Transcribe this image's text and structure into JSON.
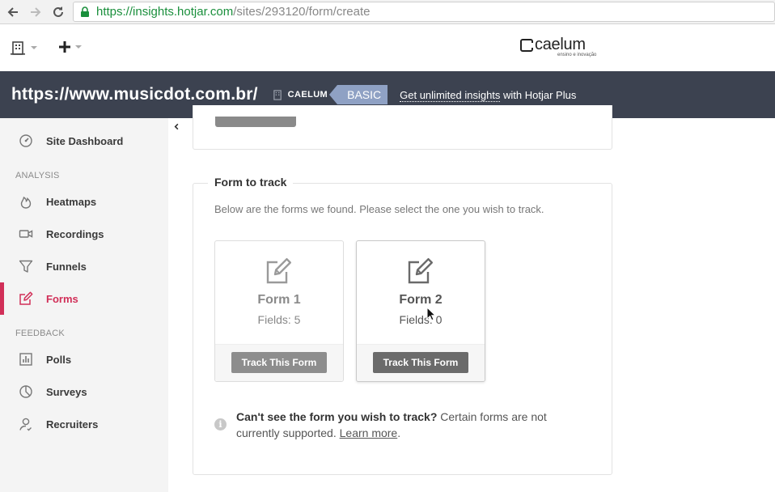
{
  "browser": {
    "url_secure_part": "https://insights.hotjar.com",
    "url_path": "/sites/293120/form/create"
  },
  "top_bar": {
    "brand_name": "caelum",
    "brand_tagline": "ensino e inovação"
  },
  "site_header": {
    "site_url": "https://www.musicdot.com.br/",
    "org_name": "CAELUM",
    "plan": "BASIC",
    "upsell_link": "Get unlimited insights",
    "upsell_rest": " with Hotjar Plus"
  },
  "sidebar": {
    "dashboard": "Site Dashboard",
    "analysis_header": "ANALYSIS",
    "heatmaps": "Heatmaps",
    "recordings": "Recordings",
    "funnels": "Funnels",
    "forms": "Forms",
    "feedback_header": "FEEDBACK",
    "polls": "Polls",
    "surveys": "Surveys",
    "recruiters": "Recruiters",
    "active_item": "Forms",
    "accent_color": "#d12f58"
  },
  "main": {
    "section_title": "Form to track",
    "intro": "Below are the forms we found. Please select the one you wish to track.",
    "forms": [
      {
        "title": "Form 1",
        "fields": "Fields: 5",
        "button": "Track This Form"
      },
      {
        "title": "Form 2",
        "fields": "Fields: 0",
        "button": "Track This Form"
      }
    ],
    "help_bold": "Can't see the form you wish to track?",
    "help_text": " Certain forms are not currently supported. ",
    "help_link": "Learn more",
    "help_end": "."
  }
}
